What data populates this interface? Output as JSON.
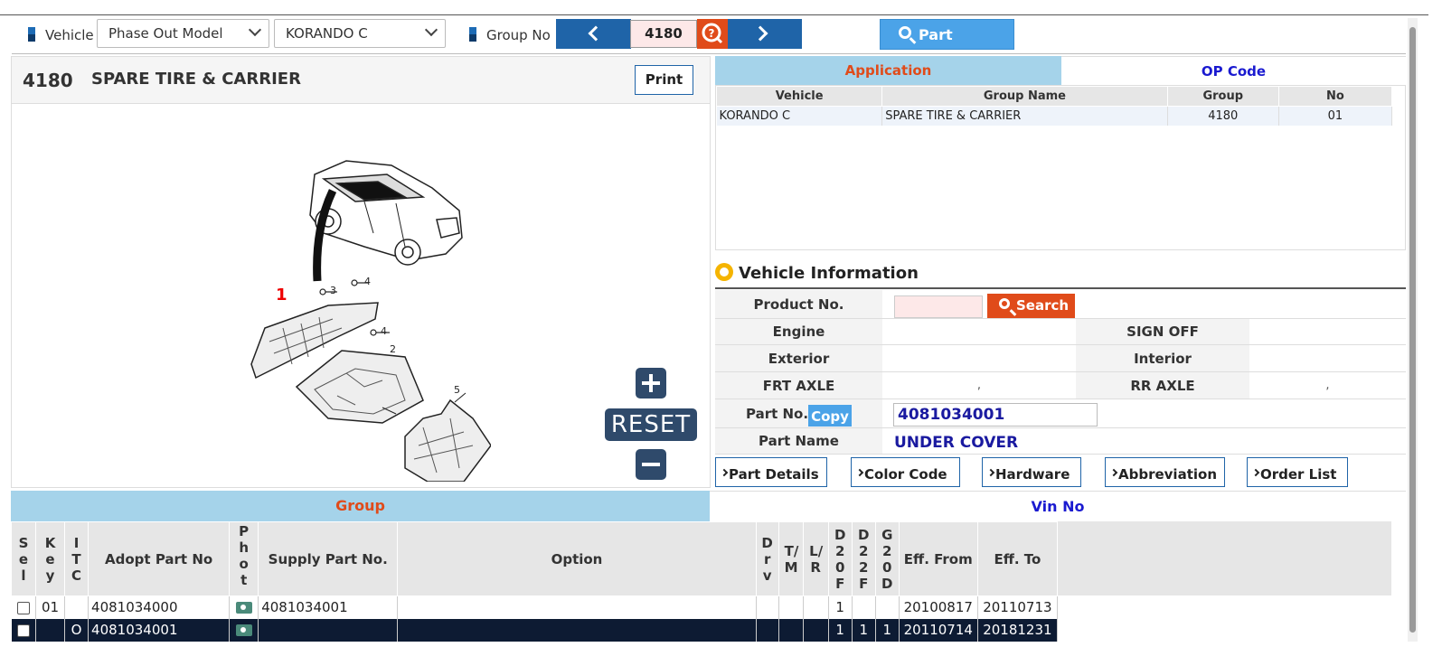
{
  "toolbar": {
    "vehicle_label": "Vehicle",
    "model_select": "Phase Out Model",
    "vehicle_select": "KORANDO C",
    "group_no_label": "Group No",
    "group_no_value": "4180",
    "part_search_label": "Part Search"
  },
  "left": {
    "group_number": "4180",
    "group_name": "SPARE TIRE & CARRIER",
    "print_label": "Print",
    "reset_label": "RESET",
    "diagram_callouts": [
      "1",
      "2",
      "3",
      "4",
      "4",
      "5"
    ]
  },
  "application": {
    "tabs": [
      "Application",
      "OP Code"
    ],
    "columns": [
      "Vehicle",
      "Group Name",
      "Group",
      "No"
    ],
    "rows": [
      {
        "vehicle": "KORANDO C",
        "group_name": "SPARE TIRE & CARRIER",
        "group": "4180",
        "no": "01"
      }
    ]
  },
  "vehicle_info": {
    "title": "Vehicle Information",
    "product_no_label": "Product No.",
    "search_label": "Search",
    "engine_label": "Engine",
    "sign_off_label": "SIGN OFF",
    "exterior_label": "Exterior",
    "interior_label": "Interior",
    "frt_axle_label": "FRT AXLE",
    "frt_axle_value": ",",
    "rr_axle_label": "RR AXLE",
    "rr_axle_value": ",",
    "part_no_label": "Part No.",
    "copy_label": "Copy",
    "part_no_value": "4081034001",
    "part_name_label": "Part Name",
    "part_name_value": "UNDER COVER"
  },
  "actions": [
    "Part Details",
    "Color Code",
    "Hardware",
    "Abbreviation",
    "Order List"
  ],
  "bottom_tabs": [
    "Group",
    "Vin No"
  ],
  "parts_table": {
    "columns": [
      "Sel",
      "Key",
      "ITC",
      "Adopt Part No",
      "Photo",
      "Supply Part No.",
      "Option",
      "Drv",
      "T/M",
      "L/R",
      "D20F",
      "D22F",
      "G20D",
      "Eff. From",
      "Eff. To"
    ],
    "rows": [
      {
        "key": "01",
        "itc": "",
        "adopt": "4081034000",
        "supply": "4081034001",
        "option": "",
        "drv": "",
        "tm": "",
        "lr": "",
        "d20f": "1",
        "d22f": "",
        "g20d": "",
        "from": "20100817",
        "to": "20110713"
      },
      {
        "key": "",
        "itc": "O",
        "adopt": "4081034001",
        "supply": "",
        "option": "",
        "drv": "",
        "tm": "",
        "lr": "",
        "d20f": "1",
        "d22f": "1",
        "g20d": "1",
        "from": "20110714",
        "to": "20181231"
      }
    ]
  },
  "colors": {
    "nav_blue": "#1f64a8",
    "accent_orange": "#e04b1a",
    "light_blue": "#4ba3e8",
    "tab_active_bg": "#a5d3ea",
    "selected_row_bg": "#0d1b33"
  }
}
